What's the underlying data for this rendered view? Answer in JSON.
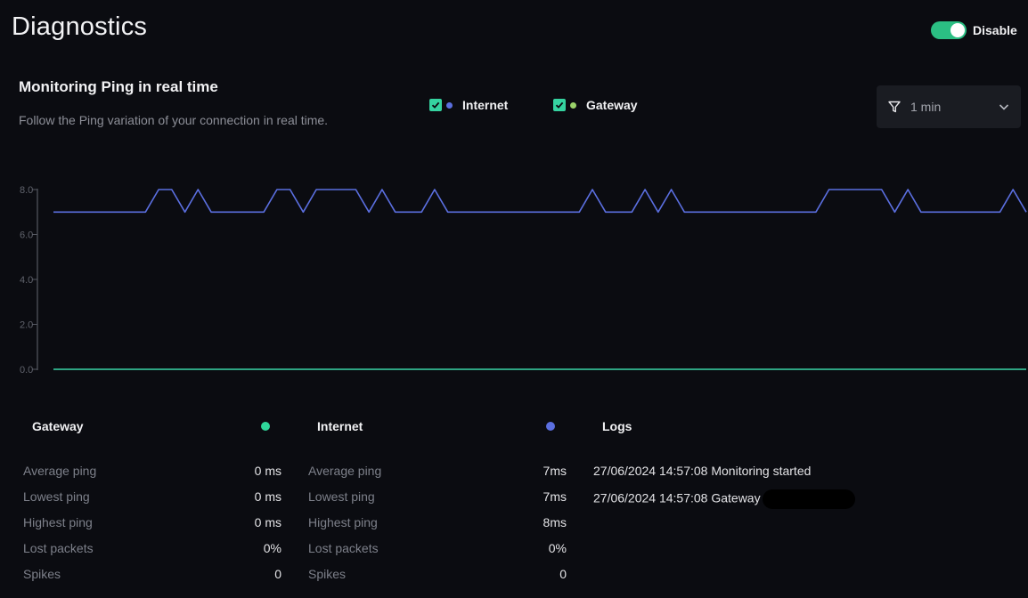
{
  "page": {
    "title": "Diagnostics"
  },
  "toggle": {
    "label": "Disable",
    "on": true,
    "color": "#2bbf83"
  },
  "monitor": {
    "title": "Monitoring Ping in real time",
    "subtitle": "Follow the Ping variation of your connection in real time."
  },
  "legend": [
    {
      "label": "Internet",
      "color": "#5b6fe0",
      "checked": true
    },
    {
      "label": "Gateway",
      "color": "#9bd36a",
      "checked": true
    }
  ],
  "filter": {
    "icon": "filter-icon",
    "value": "1 min",
    "chevron": "chevron-down-icon"
  },
  "chart_data": {
    "type": "line",
    "ylim": [
      0,
      8
    ],
    "y_ticks": [
      "0.0",
      "2.0",
      "4.0",
      "6.0",
      "8.0"
    ],
    "series": [
      {
        "name": "Internet",
        "color": "#5b6fe0",
        "values": [
          7,
          7,
          7,
          7,
          7,
          7,
          7,
          7,
          8,
          8,
          7,
          8,
          7,
          7,
          7,
          7,
          7,
          8,
          8,
          7,
          8,
          8,
          8,
          8,
          7,
          8,
          7,
          7,
          7,
          8,
          7,
          7,
          7,
          7,
          7,
          7,
          7,
          7,
          7,
          7,
          7,
          8,
          7,
          7,
          7,
          8,
          7,
          8,
          7,
          7,
          7,
          7,
          7,
          7,
          7,
          7,
          7,
          7,
          7,
          8,
          8,
          8,
          8,
          8,
          7,
          8,
          7,
          7,
          7,
          7,
          7,
          7,
          7,
          8,
          7
        ]
      },
      {
        "name": "Gateway",
        "color": "#3ad6a8",
        "values": [
          0,
          0,
          0,
          0,
          0,
          0,
          0,
          0,
          0,
          0,
          0,
          0,
          0,
          0,
          0,
          0,
          0,
          0,
          0,
          0,
          0,
          0,
          0,
          0,
          0,
          0,
          0,
          0,
          0,
          0,
          0,
          0,
          0,
          0,
          0,
          0,
          0,
          0,
          0,
          0,
          0,
          0,
          0,
          0,
          0,
          0,
          0,
          0,
          0,
          0,
          0,
          0,
          0,
          0,
          0,
          0,
          0,
          0,
          0,
          0,
          0,
          0,
          0,
          0,
          0,
          0,
          0,
          0,
          0,
          0,
          0,
          0,
          0,
          0,
          0
        ]
      }
    ]
  },
  "gateway": {
    "title": "Gateway",
    "dot_color": "#2fd89b",
    "rows": [
      {
        "label": "Average ping",
        "value": "0 ms"
      },
      {
        "label": "Lowest ping",
        "value": "0 ms"
      },
      {
        "label": "Highest ping",
        "value": "0 ms"
      },
      {
        "label": "Lost packets",
        "value": "0%"
      },
      {
        "label": "Spikes",
        "value": "0"
      }
    ]
  },
  "internet": {
    "title": "Internet",
    "dot_color": "#5b6fe0",
    "rows": [
      {
        "label": "Average ping",
        "value": "7ms"
      },
      {
        "label": "Lowest ping",
        "value": "7ms"
      },
      {
        "label": "Highest ping",
        "value": "8ms"
      },
      {
        "label": "Lost packets",
        "value": "0%"
      },
      {
        "label": "Spikes",
        "value": "0"
      }
    ]
  },
  "logs": {
    "title": "Logs",
    "entries": [
      "27/06/2024  14:57:08 Monitoring started",
      "27/06/2024  14:57:08 Gateway"
    ]
  }
}
